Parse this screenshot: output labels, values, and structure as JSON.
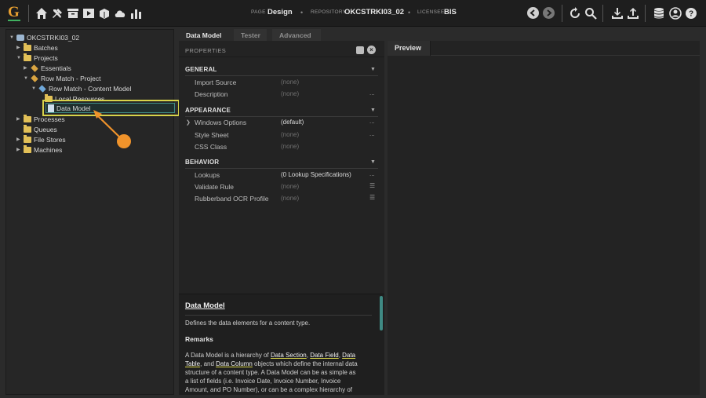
{
  "topbar": {
    "page_label": "PAGE",
    "page_value": "Design",
    "repo_label": "REPOSITORY",
    "repo_value": "OKCSTRKI03_02",
    "licensee_label": "LICENSEE",
    "licensee_value": "BIS",
    "left_icons": [
      "home-icon",
      "tools-icon",
      "archive-icon",
      "play-icon",
      "package-icon",
      "cloud-icon",
      "bar-chart-icon"
    ],
    "right_icons": [
      "back-icon",
      "forward-icon",
      "refresh-icon",
      "search-icon",
      "download-icon",
      "upload-icon",
      "database-icon",
      "user-icon",
      "help-icon"
    ]
  },
  "tree": {
    "root": "OKCSTRKI03_02",
    "items": [
      {
        "label": "Batches"
      },
      {
        "label": "Projects"
      },
      {
        "label": "Essentials"
      },
      {
        "label": "Row Match - Project"
      },
      {
        "label": "Row Match - Content Model"
      },
      {
        "label": "Local Resources"
      },
      {
        "label": "Data Model"
      },
      {
        "label": "Processes"
      },
      {
        "label": "Queues"
      },
      {
        "label": "File Stores"
      },
      {
        "label": "Machines"
      }
    ]
  },
  "tabs": [
    "Data Model",
    "Tester",
    "Advanced"
  ],
  "properties": {
    "header": "PROPERTIES",
    "sections": [
      {
        "title": "GENERAL",
        "rows": [
          {
            "name": "Import Source",
            "value": "(none)",
            "action": ""
          },
          {
            "name": "Description",
            "value": "(none)",
            "action": "..."
          }
        ]
      },
      {
        "title": "APPEARANCE",
        "rows": [
          {
            "name": "Windows Options",
            "value": "(default)",
            "action": "..."
          },
          {
            "name": "Style Sheet",
            "value": "(none)",
            "action": "..."
          },
          {
            "name": "CSS Class",
            "value": "(none)",
            "action": ""
          }
        ]
      },
      {
        "title": "BEHAVIOR",
        "rows": [
          {
            "name": "Lookups",
            "value": "(0 Lookup Specifications)",
            "action": "..."
          },
          {
            "name": "Validate Rule",
            "value": "(none)",
            "action": "☰"
          },
          {
            "name": "Rubberband OCR Profile",
            "value": "(none)",
            "action": "☰"
          }
        ]
      }
    ]
  },
  "help": {
    "title": "Data Model",
    "summary": "Defines the data elements for a content type.",
    "remarks_title": "Remarks",
    "p1": "A Data Model is a hierarchy of ",
    "l1": "Data Section",
    "s1": ", ",
    "l2": "Data Field",
    "s2": ", ",
    "l3": "Data",
    "l3b": "Table",
    "s3": ", and ",
    "l4": "Data Column",
    "p2": " objects which define the internal data",
    "p3": "structure of a content type.  A Data Model can be as simple as",
    "p4": "a list of fields (i.e. Invoice Date, Invoice Number, Invoice",
    "p5": "Amount, and PO Number), or can be a complex hierarchy of"
  },
  "preview": {
    "label": "Preview"
  },
  "colors": {
    "highlight": "#d7d34a",
    "callout": "#f0932b",
    "selection": "#3e8b85"
  }
}
